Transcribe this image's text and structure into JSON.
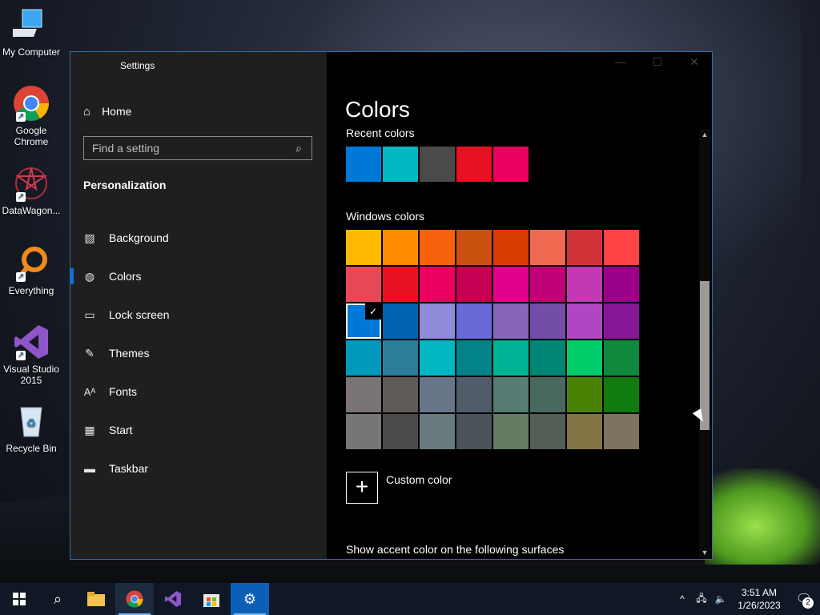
{
  "desktop": {
    "icons": [
      {
        "label": "My Computer"
      },
      {
        "label": "Google Chrome"
      },
      {
        "label": "DataWagon..."
      },
      {
        "label": "Everything"
      },
      {
        "label": "Visual Studio 2015"
      },
      {
        "label": "Recycle Bin"
      }
    ]
  },
  "window": {
    "title": "Settings",
    "home_label": "Home",
    "search_placeholder": "Find a setting",
    "section_title": "Personalization",
    "nav": [
      {
        "label": "Background",
        "icon": "image-icon"
      },
      {
        "label": "Colors",
        "icon": "palette-icon",
        "active": true
      },
      {
        "label": "Lock screen",
        "icon": "lock-screen-icon"
      },
      {
        "label": "Themes",
        "icon": "themes-icon"
      },
      {
        "label": "Fonts",
        "icon": "fonts-icon"
      },
      {
        "label": "Start",
        "icon": "start-icon"
      },
      {
        "label": "Taskbar",
        "icon": "taskbar-icon"
      }
    ]
  },
  "colors": {
    "title": "Colors",
    "recent_label": "Recent colors",
    "recent": [
      "#0078d7",
      "#00b7c3",
      "#4c4a48",
      "#e81123",
      "#ea005e"
    ],
    "windows_label": "Windows colors",
    "windows": [
      [
        "#ffb900",
        "#ff8c00",
        "#f7630c",
        "#ca5010",
        "#da3b01",
        "#ef6950",
        "#d13438",
        "#ff4343"
      ],
      [
        "#e74856",
        "#e81123",
        "#ea005e",
        "#c30052",
        "#e3008c",
        "#bf0077",
        "#c239b3",
        "#9a0089"
      ],
      [
        "#0078d7",
        "#0063b1",
        "#8e8cd8",
        "#6b69d6",
        "#8764b8",
        "#744da9",
        "#b146c2",
        "#881798"
      ],
      [
        "#0099bc",
        "#2d7d9a",
        "#00b7c3",
        "#038387",
        "#00b294",
        "#018574",
        "#00cc6a",
        "#10893e"
      ],
      [
        "#7a7574",
        "#5d5a58",
        "#68768a",
        "#515c6b",
        "#567c73",
        "#486860",
        "#498205",
        "#107c10"
      ],
      [
        "#767676",
        "#4c4a48",
        "#69797e",
        "#4a5459",
        "#647c64",
        "#525e54",
        "#847545",
        "#7e735f"
      ]
    ],
    "selected": {
      "row": 2,
      "col": 0
    },
    "custom_label": "Custom color",
    "surfaces_label": "Show accent color on the following surfaces"
  },
  "taskbar": {
    "clock_time": "3:51 AM",
    "clock_date": "1/26/2023",
    "notification_count": "2"
  }
}
